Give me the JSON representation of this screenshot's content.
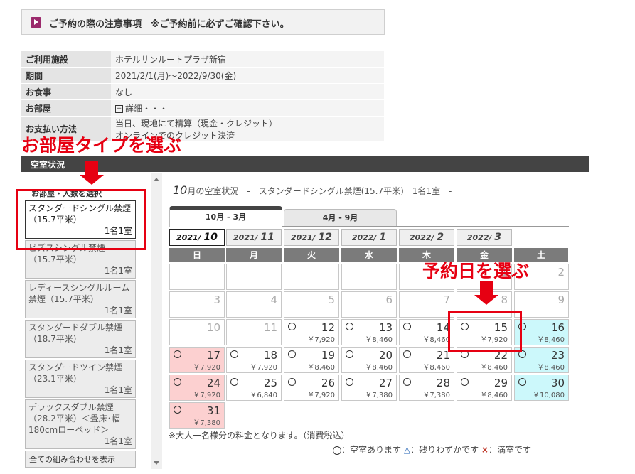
{
  "notice": {
    "text": "ご予約の際の注意事項　※ご予約前に必ずご確認下さい。"
  },
  "info": [
    {
      "label": "ご利用施設",
      "value": "ホテルサンルートプラザ新宿"
    },
    {
      "label": "期間",
      "value": "2021/2/1(月)～2022/9/30(金)"
    },
    {
      "label": "お食事",
      "value": "なし"
    },
    {
      "label": "お部屋",
      "value": "詳細・・・"
    },
    {
      "label": "お支払い方法",
      "value": "当日、現地にて精算（現金・クレジット）",
      "value2": "オンラインでのクレジット決済"
    }
  ],
  "annotations": {
    "left": "お部屋タイプを選ぶ",
    "right": "予約日を選ぶ"
  },
  "section": {
    "title": "空室状況"
  },
  "room_panel": {
    "heading": "お部屋・人数を選択",
    "rooms": [
      {
        "name": "スタンダードシングル禁煙（15.7平米）",
        "cap": "1名1室"
      },
      {
        "name": "ビズスシングル禁煙（15.7平米）",
        "cap": "1名1室"
      },
      {
        "name": "レディースシングルルーム禁煙（15.7平米）",
        "cap": "1名1室"
      },
      {
        "name": "スタンダードダブル禁煙（18.7平米）",
        "cap": "1名1室"
      },
      {
        "name": "スタンダードツイン禁煙（23.1平米）",
        "cap": "1名1室"
      },
      {
        "name": "デラックスダブル禁煙（28.2平米）＜畳床･幅180cmローベッド＞",
        "cap": "1名1室"
      }
    ],
    "all_button": "全ての組み合わせを表示"
  },
  "calendar": {
    "month": "10",
    "title_rest": "月の空室状況　-　スタンダードシングル禁煙(15.7平米)　1名1室　-",
    "tabs": [
      "10月 - 3月",
      "4月 - 9月"
    ],
    "months": [
      {
        "y": "2021/",
        "m": "10"
      },
      {
        "y": "2021/",
        "m": "11"
      },
      {
        "y": "2021/",
        "m": "12"
      },
      {
        "y": "2022/",
        "m": "1"
      },
      {
        "y": "2022/",
        "m": "2"
      },
      {
        "y": "2022/",
        "m": "3"
      }
    ],
    "weekdays": [
      "日",
      "月",
      "火",
      "水",
      "木",
      "金",
      "土"
    ],
    "days": [
      {
        "d": "",
        "s": "empty"
      },
      {
        "d": "",
        "s": "empty"
      },
      {
        "d": "",
        "s": "empty"
      },
      {
        "d": "",
        "s": "empty"
      },
      {
        "d": "",
        "s": "empty"
      },
      {
        "d": "1",
        "s": "dis"
      },
      {
        "d": "2",
        "s": "dis"
      },
      {
        "d": "3",
        "s": "dis"
      },
      {
        "d": "4",
        "s": "dis"
      },
      {
        "d": "5",
        "s": "dis"
      },
      {
        "d": "6",
        "s": "dis"
      },
      {
        "d": "7",
        "s": "dis"
      },
      {
        "d": "8",
        "s": "dis"
      },
      {
        "d": "9",
        "s": "dis"
      },
      {
        "d": "10",
        "s": "dis"
      },
      {
        "d": "11",
        "s": "dis"
      },
      {
        "d": "12",
        "s": "ok",
        "p": "￥7,920"
      },
      {
        "d": "13",
        "s": "ok",
        "p": "￥8,460"
      },
      {
        "d": "14",
        "s": "ok",
        "p": "￥8,460"
      },
      {
        "d": "15",
        "s": "ok",
        "p": "￥7,920"
      },
      {
        "d": "16",
        "s": "ok",
        "p": "￥8,460"
      },
      {
        "d": "17",
        "s": "ok",
        "p": "￥7,920"
      },
      {
        "d": "18",
        "s": "ok",
        "p": "￥7,920"
      },
      {
        "d": "19",
        "s": "ok",
        "p": "￥8,460"
      },
      {
        "d": "20",
        "s": "ok",
        "p": "￥8,460"
      },
      {
        "d": "21",
        "s": "ok",
        "p": "￥8,460"
      },
      {
        "d": "22",
        "s": "ok",
        "p": "￥8,460"
      },
      {
        "d": "23",
        "s": "ok",
        "p": "￥8,460"
      },
      {
        "d": "24",
        "s": "ok",
        "p": "￥7,920"
      },
      {
        "d": "25",
        "s": "ok",
        "p": "￥6,840"
      },
      {
        "d": "26",
        "s": "ok",
        "p": "￥7,920"
      },
      {
        "d": "27",
        "s": "ok",
        "p": "￥7,380"
      },
      {
        "d": "28",
        "s": "ok",
        "p": "￥7,380"
      },
      {
        "d": "29",
        "s": "ok",
        "p": "￥8,460"
      },
      {
        "d": "30",
        "s": "ok",
        "p": "￥10,080"
      },
      {
        "d": "31",
        "s": "ok",
        "p": "￥7,380"
      }
    ]
  },
  "note": "※大人一名様分の料金となります。（消費税込）",
  "legend": {
    "circle": "：空室あります",
    "triangle": "△",
    "triangle_label": "：残りわずかです",
    "cross": "×",
    "cross_label": "：満室です"
  }
}
